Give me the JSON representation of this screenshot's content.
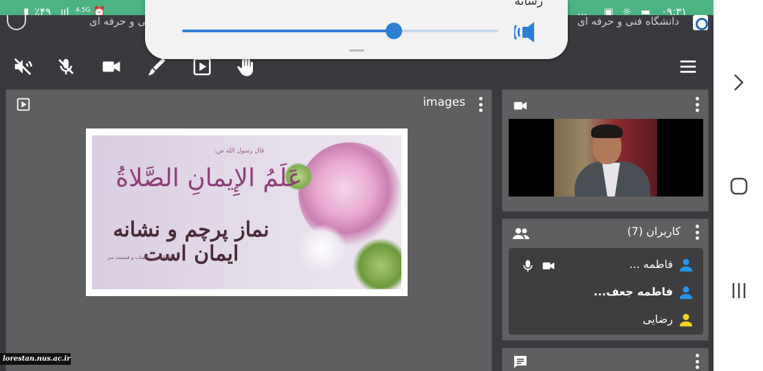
{
  "status_bar": {
    "time": "۰۹:۳۱",
    "battery": "٪۴۹",
    "network": "4.5G",
    "overflow": "..."
  },
  "header": {
    "title_right": "دانشگاه فنی و حرفه ای",
    "title_left": "دانشگاه فنی و حرفه ای"
  },
  "volume_popup": {
    "title": "رسانه",
    "level_fraction": 0.67
  },
  "toolbar": {
    "icons": [
      "volume-off-icon",
      "mic-off-icon",
      "video-camera-icon",
      "pen-icon",
      "presentation-icon",
      "raise-hand-icon",
      "menu-icon"
    ]
  },
  "presentation": {
    "title": "images",
    "slide": {
      "line_small": "قال رسول الله ص:",
      "line_arabic": "عَلَمُ الإِيمانِ الصَّلاةُ",
      "line_persian": "نماز پرچم و نشانه ایمان است",
      "line_footer": "الصلاة تفی التفتاب و قسمت سر"
    }
  },
  "users": {
    "title": "کاربران (7)",
    "list": [
      {
        "name": "فاطمه ...",
        "bold": false,
        "avatar_color": "#2196f3",
        "has_media": true
      },
      {
        "name": "فاطمه جعف...",
        "bold": true,
        "avatar_color": "#2196f3",
        "has_media": false
      },
      {
        "name": "رضایی",
        "bold": false,
        "avatar_color": "#f5d31b",
        "has_media": false
      }
    ]
  },
  "watermark": "lorestan.nus.ac.ir"
}
